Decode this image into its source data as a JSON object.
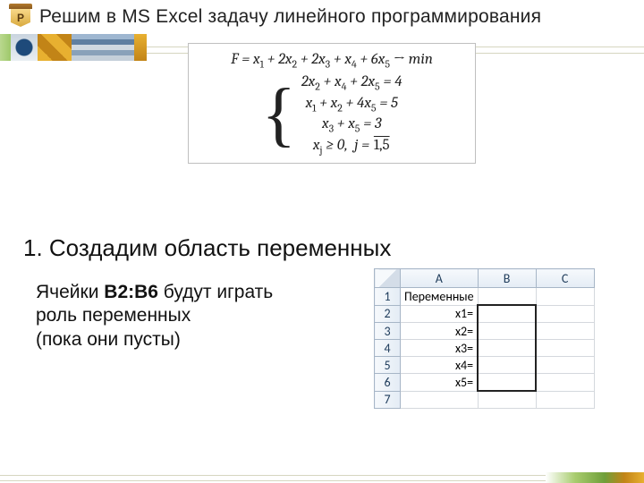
{
  "logo_letter": "P",
  "title": "Решим в MS Excel задачу линейного программирования",
  "formula": {
    "objective": "F = x₁ + 2x₂ + 2x₃ + x₄ + 6x₅ → min",
    "c1": "2x₂ + x₄ + 2x₅ = 4",
    "c2": "x₁ + x₂ + 4x₅ = 5",
    "c3": "x₃ + x₅ = 3",
    "c4_prefix": "xⱼ ≥ 0, j = ",
    "c4_over": "1,5"
  },
  "subtitle": "1. Создадим область переменных",
  "body": {
    "l1a": "Ячейки ",
    "l1b": "B2:B6",
    "l1c": " будут играть",
    "l2": "роль переменных",
    "l3": "(пока они пусты)"
  },
  "excel": {
    "cols": [
      "A",
      "B",
      "C"
    ],
    "rows": [
      "1",
      "2",
      "3",
      "4",
      "5",
      "6",
      "7"
    ],
    "a1": "Переменные",
    "labels": [
      "x1=",
      "x2=",
      "x3=",
      "x4=",
      "x5="
    ]
  },
  "chart_data": {
    "type": "table",
    "title": "Переменные",
    "columns": [
      "A",
      "B"
    ],
    "rows": [
      {
        "A": "x1=",
        "B": ""
      },
      {
        "A": "x2=",
        "B": ""
      },
      {
        "A": "x3=",
        "B": ""
      },
      {
        "A": "x4=",
        "B": ""
      },
      {
        "A": "x5=",
        "B": ""
      }
    ]
  }
}
